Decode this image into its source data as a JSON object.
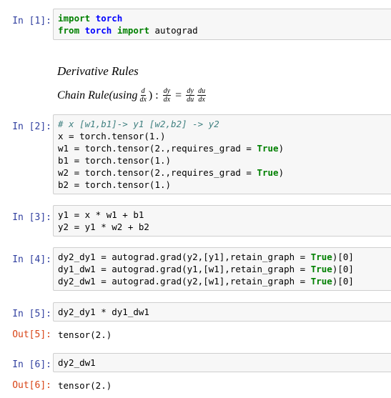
{
  "cells": [
    {
      "prompt": "In  [1]:",
      "lines": [
        [
          {
            "t": "import",
            "c": "kw"
          },
          {
            "t": " "
          },
          {
            "t": "torch",
            "c": "mod"
          }
        ],
        [
          {
            "t": "from",
            "c": "kw"
          },
          {
            "t": " "
          },
          {
            "t": "torch",
            "c": "mod"
          },
          {
            "t": " "
          },
          {
            "t": "import",
            "c": "kw"
          },
          {
            "t": " autograd"
          }
        ]
      ]
    },
    {
      "prompt": "In  [2]:",
      "lines": [
        [
          {
            "t": "# x [w1,b1]-> y1 [w2,b2] -> y2",
            "c": "cm"
          }
        ],
        [
          {
            "t": "x = torch.tensor(1.)"
          }
        ],
        [
          {
            "t": "w1 = torch.tensor(2.,requires_grad = "
          },
          {
            "t": "True",
            "c": "kw"
          },
          {
            "t": ")"
          }
        ],
        [
          {
            "t": "b1 = torch.tensor(1.)"
          }
        ],
        [
          {
            "t": "w2 = torch.tensor(2.,requires_grad = "
          },
          {
            "t": "True",
            "c": "kw"
          },
          {
            "t": ")"
          }
        ],
        [
          {
            "t": "b2 = torch.tensor(1.)"
          }
        ]
      ]
    },
    {
      "prompt": "In  [3]:",
      "lines": [
        [
          {
            "t": "y1 = x * w1 + b1"
          }
        ],
        [
          {
            "t": "y2 = y1 * w2 + b2"
          }
        ]
      ]
    },
    {
      "prompt": "In  [4]:",
      "lines": [
        [
          {
            "t": "dy2_dy1 = autograd.grad(y2,[y1],retain_graph = "
          },
          {
            "t": "True",
            "c": "kw"
          },
          {
            "t": ")[0]"
          }
        ],
        [
          {
            "t": "dy1_dw1 = autograd.grad(y1,[w1],retain_graph = "
          },
          {
            "t": "True",
            "c": "kw"
          },
          {
            "t": ")[0]"
          }
        ],
        [
          {
            "t": "dy2_dw1 = autograd.grad(y2,[w1],retain_graph = "
          },
          {
            "t": "True",
            "c": "kw"
          },
          {
            "t": ")[0]"
          }
        ]
      ]
    },
    {
      "prompt": "In  [5]:",
      "lines": [
        [
          {
            "t": "dy2_dy1 * dy1_dw1"
          }
        ]
      ],
      "out_prompt": "Out[5]:",
      "output": "tensor(2.)"
    },
    {
      "prompt": "In  [6]:",
      "lines": [
        [
          {
            "t": "dy2_dw1"
          }
        ]
      ],
      "out_prompt": "Out[6]:",
      "output": "tensor(2.)"
    }
  ],
  "markdown": {
    "heading": "Derivative Rules",
    "chain_rule_label": "Chain Rule(using",
    "using_frac_num": "d",
    "using_frac_den": "dx",
    "close_colon": ") :",
    "lhs_num": "dy",
    "lhs_den": "dx",
    "equals": "=",
    "rhs1_num": "dy",
    "rhs1_den": "du",
    "rhs2_num": "du",
    "rhs2_den": "dx"
  }
}
